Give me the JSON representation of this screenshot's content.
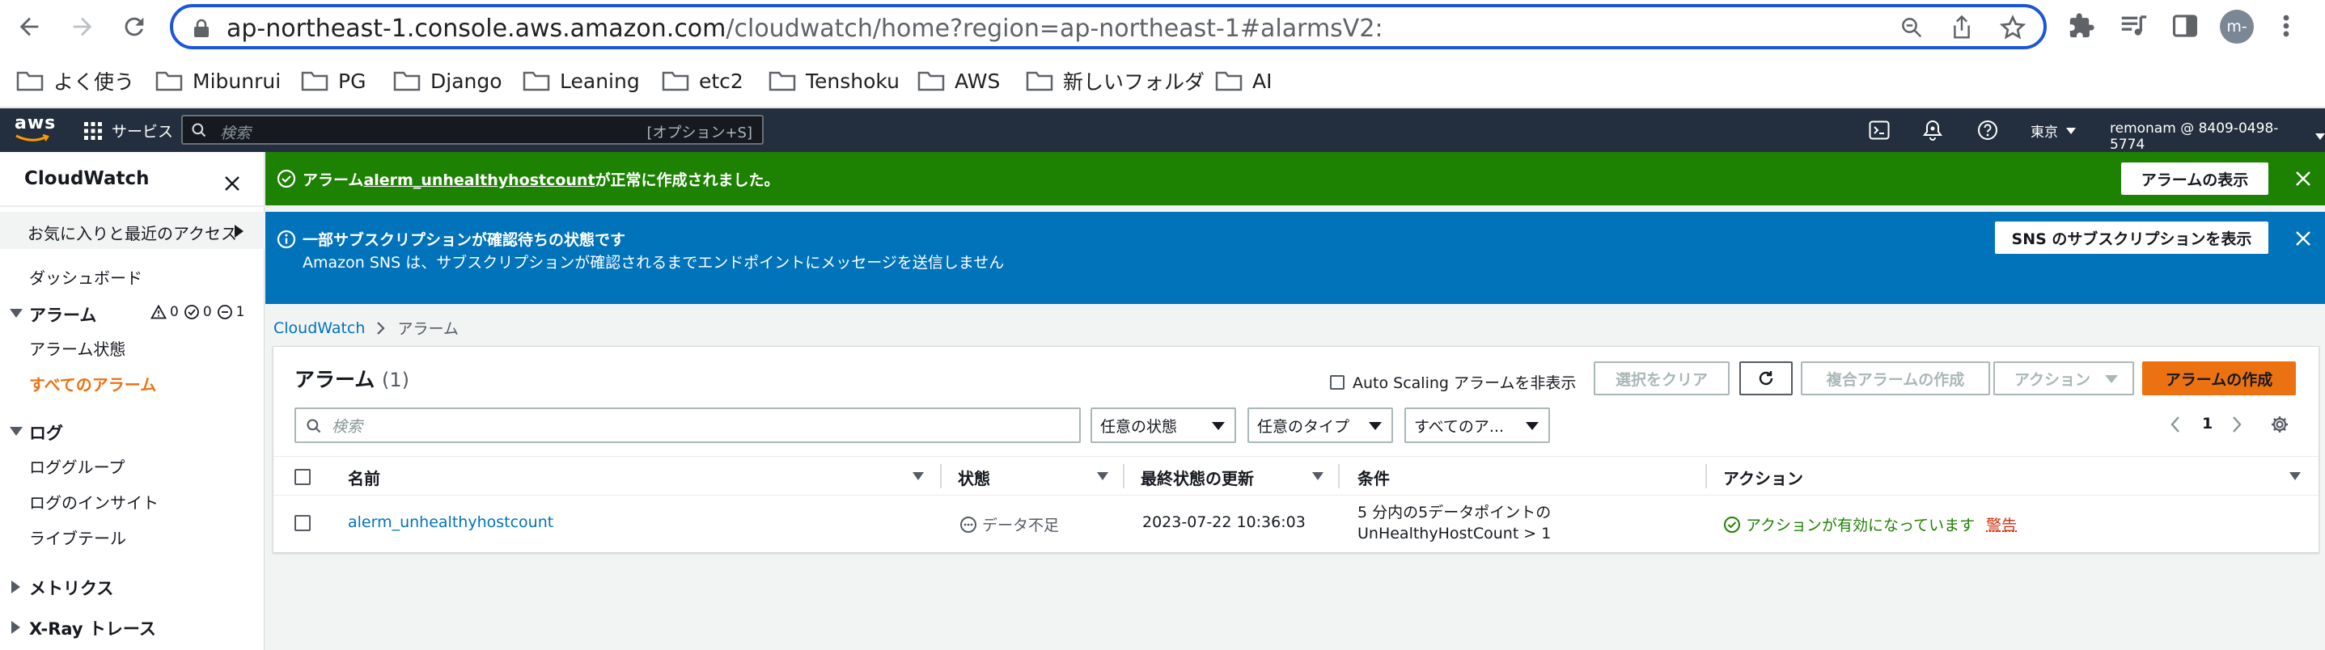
{
  "browser": {
    "url_host": "ap-northeast-1.console.aws.amazon.com",
    "url_path": "/cloudwatch/home?region=ap-northeast-1#alarmsV2:",
    "profile_initials": "m-",
    "bookmarks": [
      "よく使う",
      "Mibunrui",
      "PG",
      "Django",
      "Leaning",
      "etc2",
      "Tenshoku",
      "AWS",
      "新しいフォルダ",
      "AI"
    ]
  },
  "aws_nav": {
    "logo": "aws",
    "services_label": "サービス",
    "search_placeholder": "検索",
    "search_shortcut": "[オプション+S]",
    "region": "東京",
    "account": "remonam @ 8409-0498-5774"
  },
  "sidebar": {
    "title": "CloudWatch",
    "favorites": "お気に入りと最近のアクセス",
    "dashboard": "ダッシュボード",
    "alarms_header": "アラーム",
    "alarm_counts": {
      "in_alarm": "0",
      "ok": "0",
      "insufficient": "1"
    },
    "alarm_status": "アラーム状態",
    "all_alarms": "すべてのアラーム",
    "logs_header": "ログ",
    "log_groups": "ロググループ",
    "log_insights": "ログのインサイト",
    "live_tail": "ライブテール",
    "metrics_header": "メトリクス",
    "xray_header": "X-Ray トレース"
  },
  "flash_success": {
    "prefix": "アラーム",
    "alarm_name": "alerm_unhealthyhostcount",
    "suffix": "が正常に作成されました。",
    "button": "アラームの表示"
  },
  "flash_info": {
    "title": "一部サブスクリプションが確認待ちの状態です",
    "message": "Amazon SNS は、サブスクリプションが確認されるまでエンドポイントにメッセージを送信しません",
    "button": "SNS のサブスクリプションを表示"
  },
  "breadcrumb": {
    "root": "CloudWatch",
    "current": "アラーム"
  },
  "panel": {
    "title": "アラーム",
    "count": "(1)",
    "hide_autoscaling": "Auto Scaling アラームを非表示",
    "clear_selection": "選択をクリア",
    "create_composite": "複合アラームの作成",
    "actions": "アクション",
    "create_alarm": "アラームの作成",
    "search_placeholder": "検索",
    "filter_state": "任意の状態",
    "filter_type": "任意のタイプ",
    "filter_actions": "すべてのア...",
    "page_number": "1"
  },
  "table": {
    "headers": {
      "name": "名前",
      "state": "状態",
      "last_update": "最終状態の更新",
      "conditions": "条件",
      "actions": "アクション"
    },
    "rows": [
      {
        "name": "alerm_unhealthyhostcount",
        "state": "データ不足",
        "last_update": "2023-07-22 10:36:03",
        "condition_line1": "5 分内の5データポイントの",
        "condition_line2": "UnHealthyHostCount > 1",
        "actions_enabled": "アクションが有効になっています",
        "actions_warning": "警告"
      }
    ]
  },
  "colors": {
    "aws_nav": "#232f3e",
    "success": "#1d8102",
    "info": "#0073bb",
    "primary_button": "#ec7211",
    "link": "#0073bb",
    "active_nav": "#ec7211"
  }
}
